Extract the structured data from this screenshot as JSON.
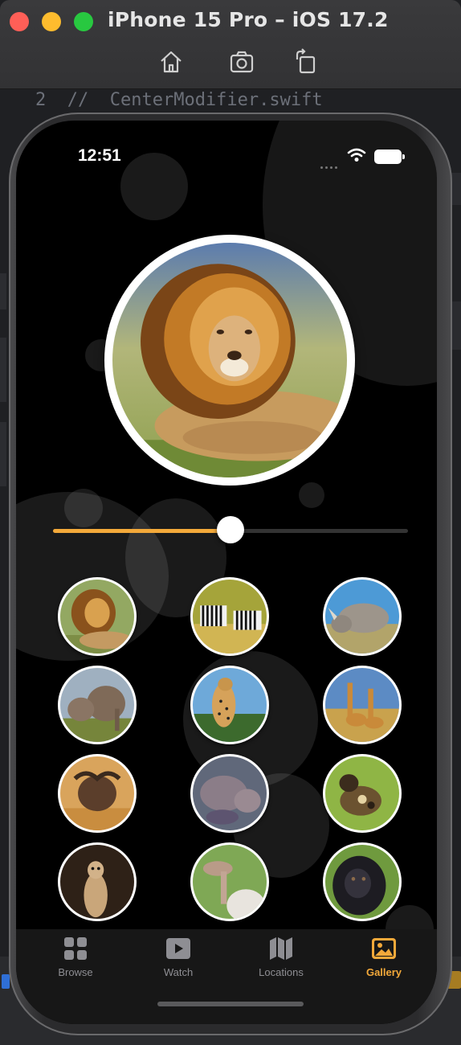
{
  "simulator": {
    "title": "iPhone 15 Pro – iOS 17.2",
    "toolbar": [
      "home-icon",
      "screenshot-icon",
      "rotate-icon"
    ]
  },
  "editor": {
    "line_number": "2",
    "code": "//  CenterModifier.swift"
  },
  "status_bar": {
    "time": "12:51",
    "icons": [
      "cellular-dots-icon",
      "wifi-icon",
      "battery-icon"
    ]
  },
  "slider": {
    "value": 0.5,
    "accent": "#f3a93a"
  },
  "gallery": {
    "selected": "lion",
    "items": [
      "lion",
      "zebra",
      "rhino",
      "elephant",
      "cheetah",
      "giraffe",
      "buffalo",
      "hippo",
      "wild-dog",
      "meerkat",
      "ostrich",
      "gorilla"
    ]
  },
  "tabs": [
    {
      "label": "Browse",
      "icon": "grid-icon"
    },
    {
      "label": "Watch",
      "icon": "play-icon"
    },
    {
      "label": "Locations",
      "icon": "map-icon"
    },
    {
      "label": "Gallery",
      "icon": "photo-icon",
      "active": true
    }
  ],
  "colors": {
    "accent": "#f3a93a",
    "inactive_tab": "#8e8e93",
    "background": "#000000"
  }
}
